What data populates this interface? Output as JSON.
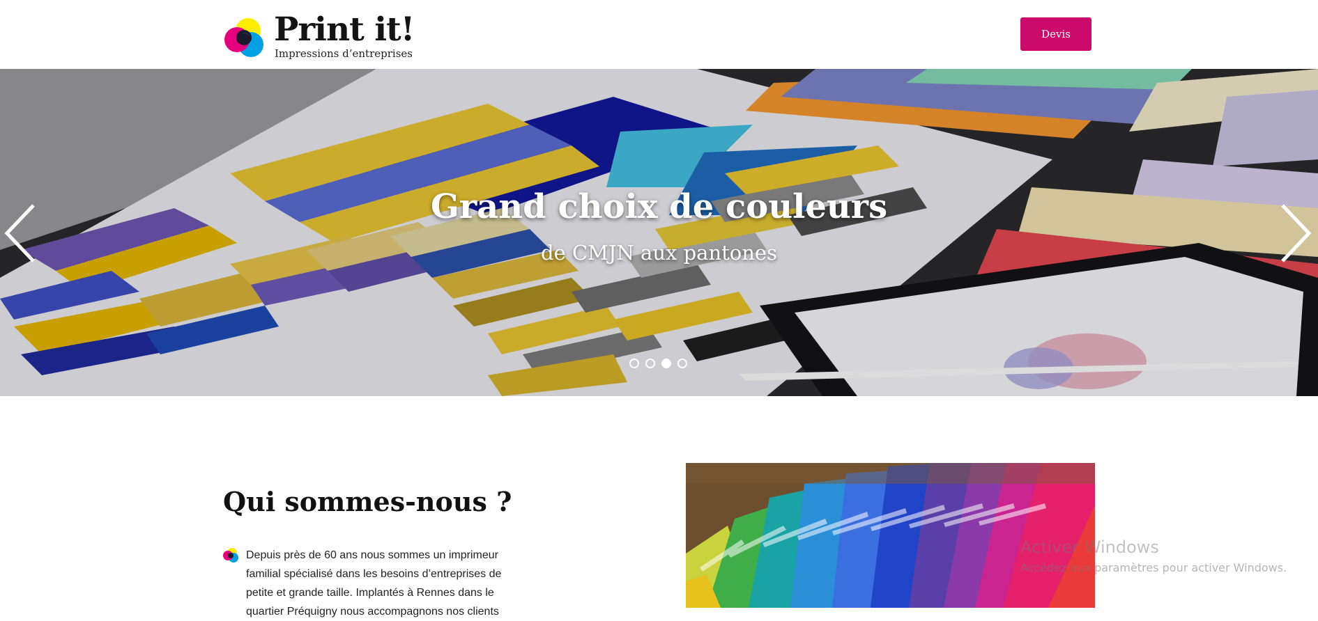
{
  "header": {
    "logo_title": "Print it!",
    "logo_subtitle": "Impressions d’entreprises",
    "devis_label": "Devis"
  },
  "hero": {
    "title": "Grand choix de couleurs",
    "subtitle": "de CMJN aux pantones",
    "slide_count": 4,
    "active_slide": 3
  },
  "about": {
    "title": "Qui sommes-nous ?",
    "text": "Depuis près de 60 ans nous sommes un imprimeur familial spécialisé dans les besoins d’entreprises de petite et grande taille. Implantés à Rennes dans le quartier Préquigny nous accompagnons nos clients"
  },
  "watermark": {
    "title": "Activer Windows",
    "subtitle": "Accédez aux paramètres pour activer Windows."
  },
  "colors": {
    "brand": "#cc0a6b",
    "logo_cyan": "#00a0e3",
    "logo_magenta": "#e5007e",
    "logo_yellow": "#ffed00"
  },
  "icons": [
    "cmyk-logo-icon",
    "chevron-left-icon",
    "chevron-right-icon",
    "cmyk-bullet-icon"
  ]
}
